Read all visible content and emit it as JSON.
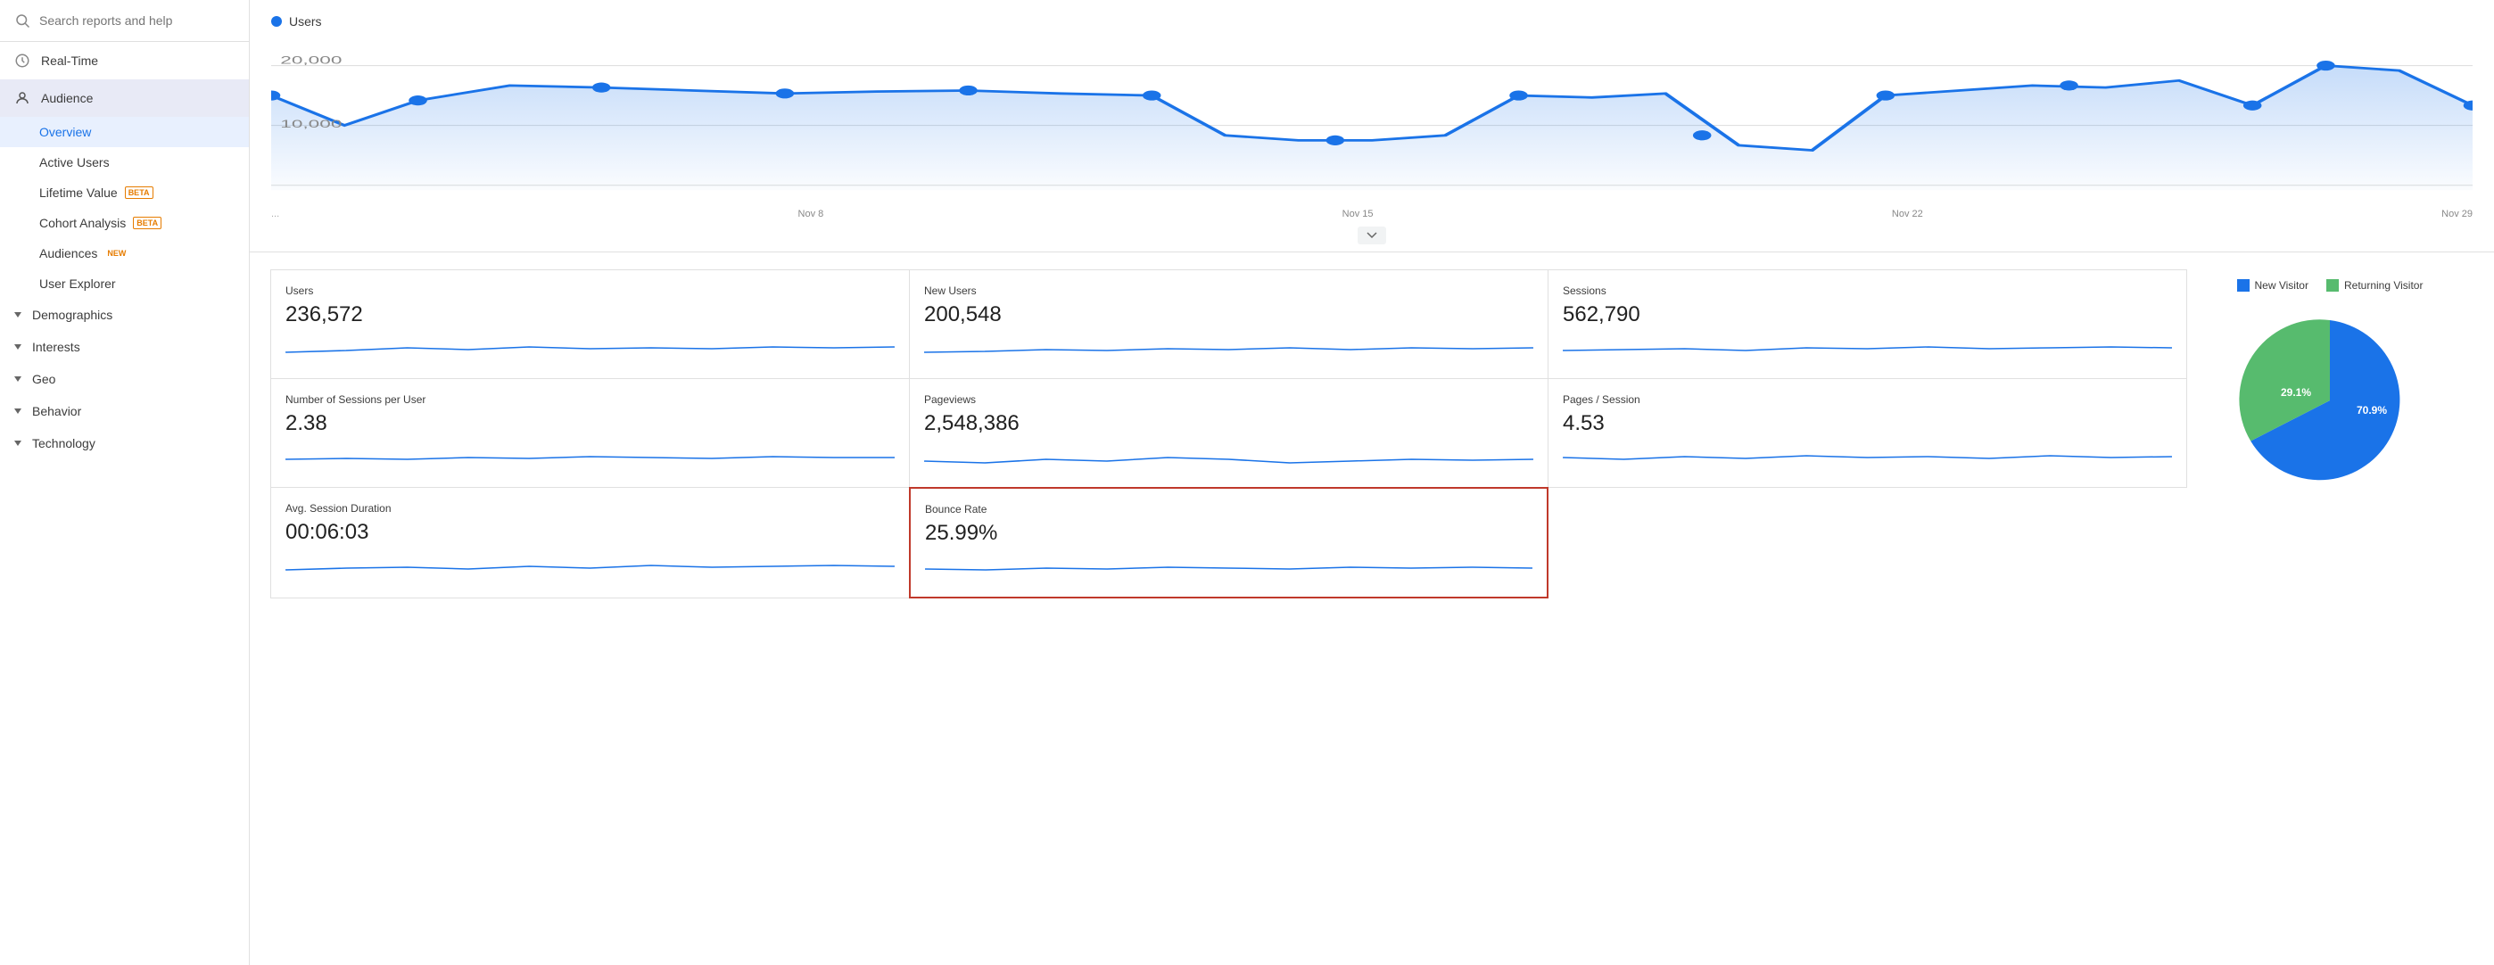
{
  "sidebar": {
    "search_placeholder": "Search reports and help",
    "items": [
      {
        "id": "real-time",
        "label": "Real-Time",
        "icon": "clock"
      },
      {
        "id": "audience",
        "label": "Audience",
        "icon": "person",
        "active": true
      }
    ],
    "sub_items": [
      {
        "id": "overview",
        "label": "Overview",
        "active": true
      },
      {
        "id": "active-users",
        "label": "Active Users"
      },
      {
        "id": "lifetime-value",
        "label": "Lifetime Value",
        "badge": "BETA",
        "badge_type": "beta"
      },
      {
        "id": "cohort-analysis",
        "label": "Cohort Analysis",
        "badge": "BETA",
        "badge_type": "beta"
      },
      {
        "id": "audiences",
        "label": "Audiences",
        "badge": "NEW",
        "badge_type": "new"
      },
      {
        "id": "user-explorer",
        "label": "User Explorer"
      }
    ],
    "sections": [
      {
        "id": "demographics",
        "label": "Demographics"
      },
      {
        "id": "interests",
        "label": "Interests"
      },
      {
        "id": "geo",
        "label": "Geo"
      },
      {
        "id": "behavior",
        "label": "Behavior"
      },
      {
        "id": "technology",
        "label": "Technology"
      }
    ]
  },
  "chart": {
    "legend_label": "Users",
    "y_labels": [
      "20,000",
      "",
      "10,000",
      ""
    ],
    "x_labels": [
      "...",
      "Nov 8",
      "Nov 15",
      "Nov 22",
      "Nov 29"
    ]
  },
  "metrics": [
    {
      "id": "users",
      "label": "Users",
      "value": "236,572"
    },
    {
      "id": "new-users",
      "label": "New Users",
      "value": "200,548"
    },
    {
      "id": "sessions",
      "label": "Sessions",
      "value": "562,790"
    },
    {
      "id": "sessions-per-user",
      "label": "Number of Sessions per User",
      "value": "2.38"
    },
    {
      "id": "pageviews",
      "label": "Pageviews",
      "value": "2,548,386"
    },
    {
      "id": "pages-per-session",
      "label": "Pages / Session",
      "value": "4.53"
    },
    {
      "id": "avg-session-duration",
      "label": "Avg. Session Duration",
      "value": "00:06:03"
    },
    {
      "id": "bounce-rate",
      "label": "Bounce Rate",
      "value": "25.99%",
      "highlighted": true
    }
  ],
  "pie_chart": {
    "legend": [
      {
        "id": "new-visitor",
        "label": "New Visitor",
        "color": "#1a73e8"
      },
      {
        "id": "returning-visitor",
        "label": "Returning Visitor",
        "color": "#57bb6e"
      }
    ],
    "segments": [
      {
        "id": "new-visitor",
        "value": 70.9,
        "label": "70.9%",
        "color": "#1a73e8"
      },
      {
        "id": "returning-visitor",
        "value": 29.1,
        "label": "29.1%",
        "color": "#57bb6e"
      }
    ]
  }
}
